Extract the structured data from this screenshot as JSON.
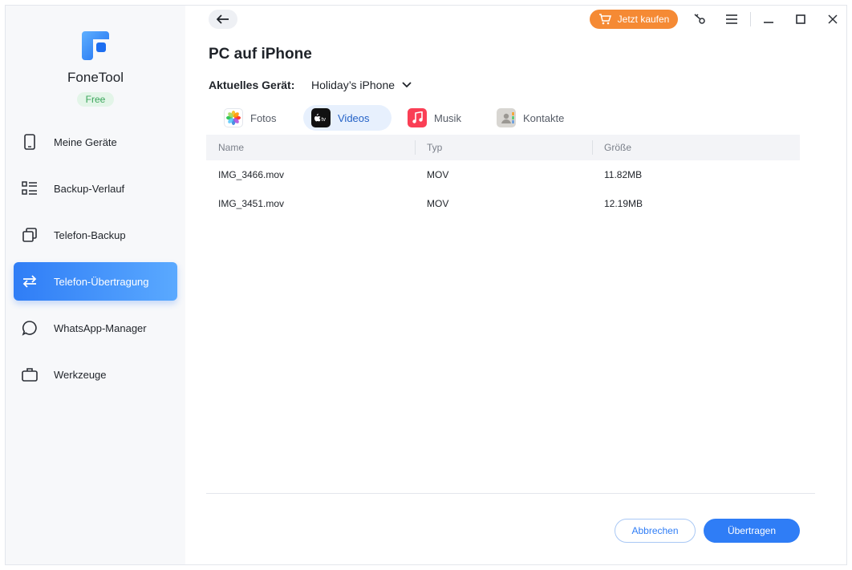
{
  "app": {
    "name": "FoneTool",
    "badge": "Free"
  },
  "sidebar": {
    "items": [
      {
        "label": "Meine Geräte",
        "icon": "phone-icon"
      },
      {
        "label": "Backup-Verlauf",
        "icon": "list-icon"
      },
      {
        "label": "Telefon-Backup",
        "icon": "copy-icon"
      },
      {
        "label": "Telefon-Übertragung",
        "icon": "transfer-arrows-icon",
        "active": true
      },
      {
        "label": "WhatsApp-Manager",
        "icon": "chat-bubble-icon"
      },
      {
        "label": "Werkzeuge",
        "icon": "toolbox-icon"
      }
    ]
  },
  "topbar": {
    "buy_label": "Jetzt kaufen",
    "icons": [
      "back-arrow-icon",
      "cart-icon",
      "key-icon",
      "menu-icon",
      "minimize-icon",
      "maximize-icon",
      "close-icon"
    ]
  },
  "main": {
    "title": "PC auf iPhone",
    "device_label": "Aktuelles Gerät:",
    "device_value": "Holiday’s iPhone",
    "tabs": [
      {
        "label": "Fotos",
        "icon": "photos-icon"
      },
      {
        "label": "Videos",
        "icon": "apple-tv-icon",
        "active": true
      },
      {
        "label": "Musik",
        "icon": "music-icon"
      },
      {
        "label": "Kontakte",
        "icon": "contacts-icon"
      }
    ],
    "table": {
      "headers": [
        "Name",
        "Typ",
        "Größe"
      ],
      "rows": [
        [
          "IMG_3466.mov",
          "MOV",
          "11.82MB"
        ],
        [
          "IMG_3451.mov",
          "MOV",
          "12.19MB"
        ]
      ]
    },
    "cancel_label": "Abbrechen",
    "transfer_label": "Übertragen"
  },
  "colors": {
    "accent": "#2f7df6",
    "buy": "#f58a34",
    "badge_text": "#3aa55a"
  }
}
